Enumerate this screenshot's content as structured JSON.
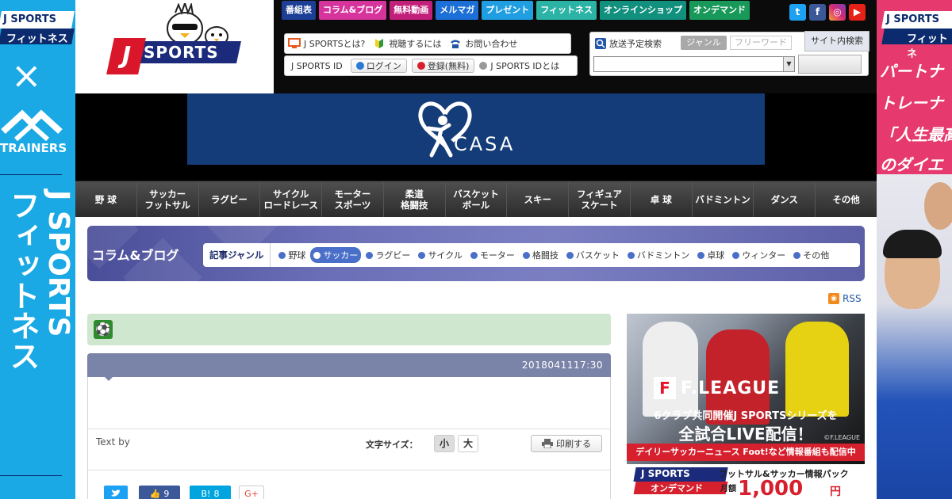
{
  "side_left": {
    "brand_line1": "J SPORTS",
    "brand_line2": "フィットネス",
    "times": "×",
    "trainers": "TRAINERS",
    "vertical_a": "J SPORTS",
    "vertical_b": "フィットネス"
  },
  "side_right": {
    "brand_line1": "J SPORTS",
    "brand_line2": "フィットネ",
    "line1": "パートナ",
    "line2": "トレーナ",
    "line3": "「人生最高",
    "line4": "のダイエ"
  },
  "logo": {
    "j": "J",
    "text": "SPORTS"
  },
  "topnav": [
    {
      "label": "番組表",
      "color": "#1c3f95"
    },
    {
      "label": "コラム&ブログ",
      "color": "#d6339c"
    },
    {
      "label": "無料動画",
      "color": "#c21f7a"
    },
    {
      "label": "メルマガ",
      "color": "#1c6fd6"
    },
    {
      "label": "プレゼント",
      "color": "#1f9ee2"
    },
    {
      "label": "フィットネス",
      "color": "#2bb3a6"
    },
    {
      "label": "オンラインショップ",
      "color": "#12907e"
    },
    {
      "label": "オンデマンド",
      "color": "#18995a"
    }
  ],
  "social": {
    "twitter": "t",
    "facebook": "f",
    "instagram": "◎",
    "youtube": "▶"
  },
  "info": {
    "about": "J SPORTSとは?",
    "howto": "視聴するには",
    "contact": "お問い合わせ",
    "id_label": "J SPORTS ID",
    "login": "ログイン",
    "register": "登録(無料)",
    "id_about": "J SPORTS IDとは"
  },
  "search": {
    "title": "放送予定検索",
    "genre": "ジャンル",
    "freeword": "フリーワード",
    "site_search": "サイト内検索"
  },
  "banner": {
    "text": "CASA"
  },
  "mainnav": [
    "野 球",
    "サッカー\nフットサル",
    "ラグビー",
    "サイクル\nロードレース",
    "モーター\nスポーツ",
    "柔道\n格闘技",
    "バスケット\nボール",
    "スキー",
    "フィギュア\nスケート",
    "卓 球",
    "バドミントン",
    "ダンス",
    "その他"
  ],
  "column": {
    "title": "コラム&ブログ",
    "genre_label": "記事ジャンル",
    "genres": [
      "野球",
      "サッカー",
      "ラグビー",
      "サイクル",
      "モーター",
      "格闘技",
      "バスケット",
      "バドミントン",
      "卓球",
      "ウィンター",
      "その他"
    ],
    "active_index": 1
  },
  "rss": "RSS",
  "article": {
    "date": "2018041117:30",
    "text_by": "Text by",
    "font_size_label": "文字サイズ：",
    "small": "小",
    "large": "大",
    "print": "印刷する",
    "share": {
      "twitter": "",
      "like": "9",
      "hatena": "B!",
      "hatena_count": "8",
      "gplus": "G+"
    }
  },
  "ad": {
    "logo_f": "F",
    "logo_text": "F.LEAGUE",
    "line1": "6クラブ共同開催J SPORTSシリーズを",
    "line2": "全試合LIVE配信！",
    "copyright": "©F.LEAGUE",
    "bar": "デイリーサッカーニュース Foot!など情報番組も配信中",
    "jod1": "J SPORTS",
    "jod2": "オンデマンド",
    "pack": "フットサル&サッカー情報パック",
    "month": "月額",
    "price": "1,000",
    "yen": "円"
  },
  "colors": {
    "header_bg": "#0b0b0b",
    "brand_blue": "#1b2a7a",
    "brand_red": "#d9162a",
    "column_accent": "#4a6fc8"
  }
}
